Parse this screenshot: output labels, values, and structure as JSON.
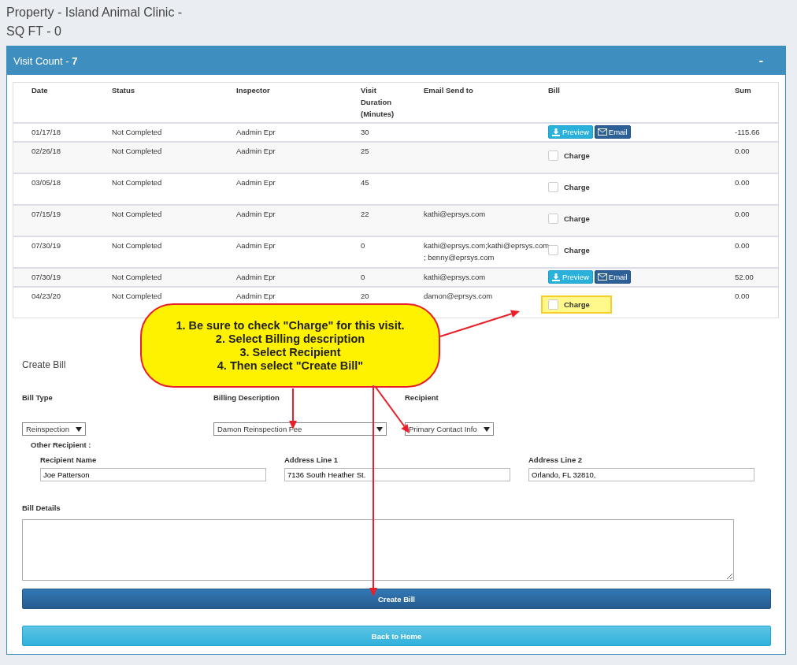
{
  "page_title": [
    "Property - Island Animal Clinic -",
    "SQ FT - 0"
  ],
  "panel": {
    "title": "Visit Count - **7**",
    "collapse": "-",
    "expanded": true
  },
  "table": {
    "columns": [
      "Date",
      "Status",
      "Inspector",
      "Visit Duration (Minutes)",
      "Email Send to",
      "Bill",
      "Sum"
    ],
    "rows": [
      {
        "date": "01/17/18",
        "status": "Not Completed",
        "inspector": "Aadmin Epr",
        "duration": "30",
        "email": "",
        "bill": {
          "kind": "buttons",
          "preview": "Preview",
          "send": "Email"
        },
        "sum": "-115.66"
      },
      {
        "date": "02/26/18",
        "status": "Not Completed",
        "inspector": "Aadmin Epr",
        "duration": "25",
        "email": "",
        "bill": {
          "kind": "charge",
          "label": "Charge",
          "checked": false,
          "highlighted": false
        },
        "sum": "0.00"
      },
      {
        "date": "03/05/18",
        "status": "Not Completed",
        "inspector": "Aadmin Epr",
        "duration": "45",
        "email": "",
        "bill": {
          "kind": "charge",
          "label": "Charge",
          "checked": false,
          "highlighted": false
        },
        "sum": "0.00"
      },
      {
        "date": "07/15/19",
        "status": "Not Completed",
        "inspector": "Aadmin Epr",
        "duration": "22",
        "email": "kathi@eprsys.com",
        "bill": {
          "kind": "charge",
          "label": "Charge",
          "checked": false,
          "highlighted": false
        },
        "sum": "0.00"
      },
      {
        "date": "07/30/19",
        "status": "Not Completed",
        "inspector": "Aadmin Epr",
        "duration": "0",
        "email": "kathi@eprsys.com;kathi@eprsys.com ; benny@eprsys.com",
        "bill": {
          "kind": "charge",
          "label": "Charge",
          "checked": false,
          "highlighted": false
        },
        "sum": "0.00"
      },
      {
        "date": "07/30/19",
        "status": "Not Completed",
        "inspector": "Aadmin Epr",
        "duration": "0",
        "email": "kathi@eprsys.com",
        "bill": {
          "kind": "buttons",
          "preview": "Preview",
          "send": "Email"
        },
        "sum": "52.00"
      },
      {
        "date": "04/23/20",
        "status": "Not Completed",
        "inspector": "Aadmin Epr",
        "duration": "20",
        "email": "damon@eprsys.com",
        "bill": {
          "kind": "charge",
          "label": "Charge",
          "checked": false,
          "highlighted": true
        },
        "sum": "0.00"
      }
    ]
  },
  "form": {
    "heading": "Create Bill",
    "selects": [
      {
        "label": "Bill Type",
        "value": "Reinspection"
      },
      {
        "label": "Billing Description",
        "value": "Damon Reinspection Fee"
      },
      {
        "label": "Recipient",
        "value": "Primary Contact Info"
      }
    ],
    "other_recipient": "Other Recipient :",
    "fields": [
      {
        "label": "Recipient Name",
        "value": "Joe Patterson"
      },
      {
        "label": "Address Line 1",
        "value": "7136 South Heather St."
      },
      {
        "label": "Address Line 2",
        "value": "Orlando, FL 32810,"
      }
    ],
    "details_label": "Bill Details",
    "buttons": [
      {
        "kind": "primary",
        "label": "Create Bill"
      },
      {
        "kind": "info",
        "label": "Back to Home"
      }
    ]
  },
  "callout": "1. Be sure to check \"Charge\" for this visit.\n2. Select Billing description\n3. Select Recipient\n4. Then select \"Create Bill\""
}
